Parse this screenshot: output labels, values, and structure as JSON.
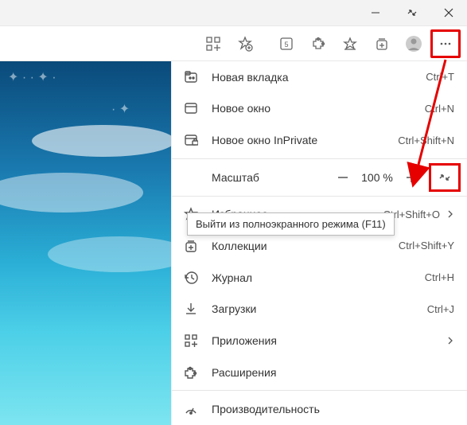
{
  "titlebar": {
    "minimize": "—",
    "restore": "⇲",
    "close": "✕"
  },
  "menu": {
    "new_tab": {
      "label": "Новая вкладка",
      "shortcut": "Ctrl+T"
    },
    "new_window": {
      "label": "Новое окно",
      "shortcut": "Ctrl+N"
    },
    "new_inprivate": {
      "label": "Новое окно InPrivate",
      "shortcut": "Ctrl+Shift+N"
    },
    "zoom": {
      "label": "Масштаб",
      "value": "100 %"
    },
    "favorites": {
      "label": "Избранное",
      "shortcut": "Ctrl+Shift+O"
    },
    "collections": {
      "label": "Коллекции",
      "shortcut": "Ctrl+Shift+Y"
    },
    "history": {
      "label": "Журнал",
      "shortcut": "Ctrl+H"
    },
    "downloads": {
      "label": "Загрузки",
      "shortcut": "Ctrl+J"
    },
    "apps": {
      "label": "Приложения"
    },
    "extensions": {
      "label": "Расширения"
    },
    "performance": {
      "label": "Производительность"
    }
  },
  "tooltip": "Выйти из полноэкранного режима (F11)"
}
